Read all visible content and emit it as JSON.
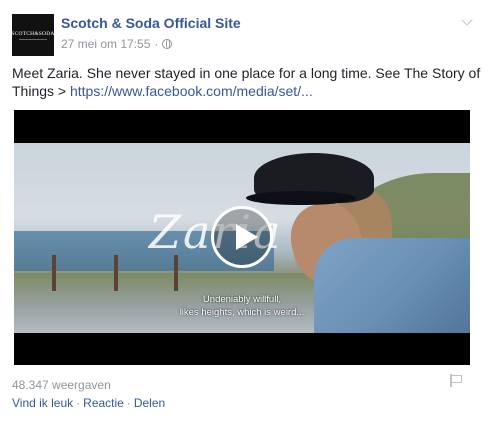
{
  "post": {
    "avatar_text": "SCOTCH&SODA",
    "page_name": "Scotch & Soda Official Site",
    "timestamp": "27 mei om 17:55",
    "separator": "·",
    "icons": {
      "privacy": "globe-icon",
      "options": "chevron-down-icon",
      "report": "flag-icon",
      "play": "play-icon"
    },
    "text": "Meet Zaria. She never stayed in one place for a long time. See The Story of Things >",
    "link": "https://www.facebook.com/media/set/...",
    "video": {
      "overlay_title": "Zaria",
      "subtitle_line1": "Undeniably willfull,",
      "subtitle_line2": "likes heights, which is weird..."
    },
    "views": "48.347 weergaven",
    "actions": {
      "like": "Vind ik leuk",
      "comment": "Reactie",
      "share": "Delen"
    }
  },
  "colors": {
    "link": "#365899",
    "meta": "#90949c",
    "text": "#1d2129"
  }
}
